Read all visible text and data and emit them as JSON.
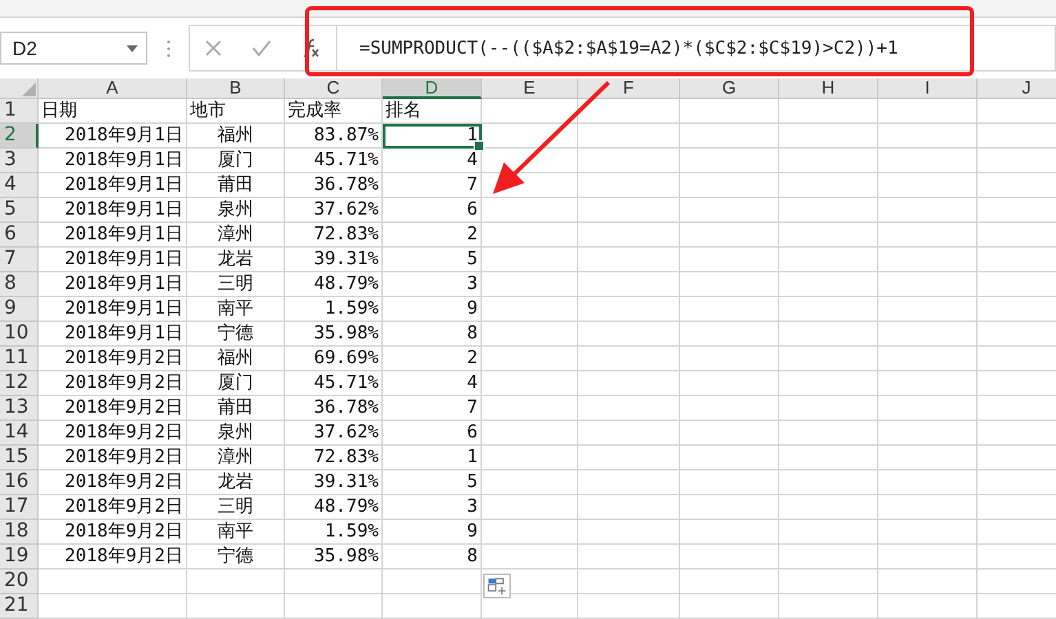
{
  "name_box": {
    "value": "D2"
  },
  "formula_bar": {
    "formula": "=SUMPRODUCT(--(($A$2:$A$19=A2)*($C$2:$C$19)>C2))+1"
  },
  "columns": [
    {
      "label": "A",
      "selected": false
    },
    {
      "label": "B",
      "selected": false
    },
    {
      "label": "C",
      "selected": false
    },
    {
      "label": "D",
      "selected": true
    },
    {
      "label": "E",
      "selected": false
    },
    {
      "label": "F",
      "selected": false
    },
    {
      "label": "G",
      "selected": false
    },
    {
      "label": "H",
      "selected": false
    },
    {
      "label": "I",
      "selected": false
    },
    {
      "label": "J",
      "selected": false
    }
  ],
  "rows": [
    {
      "number": "1",
      "kind": "header",
      "selected": false,
      "cells": [
        "日期",
        "地市",
        "完成率",
        "排名"
      ]
    },
    {
      "number": "2",
      "kind": "data",
      "selected": true,
      "cells": [
        "2018年9月1日",
        "福州",
        "83.87%",
        "1"
      ]
    },
    {
      "number": "3",
      "kind": "data",
      "selected": false,
      "cells": [
        "2018年9月1日",
        "厦门",
        "45.71%",
        "4"
      ]
    },
    {
      "number": "4",
      "kind": "data",
      "selected": false,
      "cells": [
        "2018年9月1日",
        "莆田",
        "36.78%",
        "7"
      ]
    },
    {
      "number": "5",
      "kind": "data",
      "selected": false,
      "cells": [
        "2018年9月1日",
        "泉州",
        "37.62%",
        "6"
      ]
    },
    {
      "number": "6",
      "kind": "data",
      "selected": false,
      "cells": [
        "2018年9月1日",
        "漳州",
        "72.83%",
        "2"
      ]
    },
    {
      "number": "7",
      "kind": "data",
      "selected": false,
      "cells": [
        "2018年9月1日",
        "龙岩",
        "39.31%",
        "5"
      ]
    },
    {
      "number": "8",
      "kind": "data",
      "selected": false,
      "cells": [
        "2018年9月1日",
        "三明",
        "48.79%",
        "3"
      ]
    },
    {
      "number": "9",
      "kind": "data",
      "selected": false,
      "cells": [
        "2018年9月1日",
        "南平",
        "1.59%",
        "9"
      ]
    },
    {
      "number": "10",
      "kind": "data",
      "selected": false,
      "cells": [
        "2018年9月1日",
        "宁德",
        "35.98%",
        "8"
      ]
    },
    {
      "number": "11",
      "kind": "data",
      "selected": false,
      "cells": [
        "2018年9月2日",
        "福州",
        "69.69%",
        "2"
      ]
    },
    {
      "number": "12",
      "kind": "data",
      "selected": false,
      "cells": [
        "2018年9月2日",
        "厦门",
        "45.71%",
        "4"
      ]
    },
    {
      "number": "13",
      "kind": "data",
      "selected": false,
      "cells": [
        "2018年9月2日",
        "莆田",
        "36.78%",
        "7"
      ]
    },
    {
      "number": "14",
      "kind": "data",
      "selected": false,
      "cells": [
        "2018年9月2日",
        "泉州",
        "37.62%",
        "6"
      ]
    },
    {
      "number": "15",
      "kind": "data",
      "selected": false,
      "cells": [
        "2018年9月2日",
        "漳州",
        "72.83%",
        "1"
      ]
    },
    {
      "number": "16",
      "kind": "data",
      "selected": false,
      "cells": [
        "2018年9月2日",
        "龙岩",
        "39.31%",
        "5"
      ]
    },
    {
      "number": "17",
      "kind": "data",
      "selected": false,
      "cells": [
        "2018年9月2日",
        "三明",
        "48.79%",
        "3"
      ]
    },
    {
      "number": "18",
      "kind": "data",
      "selected": false,
      "cells": [
        "2018年9月2日",
        "南平",
        "1.59%",
        "9"
      ]
    },
    {
      "number": "19",
      "kind": "data",
      "selected": false,
      "cells": [
        "2018年9月2日",
        "宁德",
        "35.98%",
        "8"
      ]
    },
    {
      "number": "20",
      "kind": "empty",
      "selected": false,
      "cells": []
    },
    {
      "number": "21",
      "kind": "empty",
      "selected": false,
      "cells": []
    }
  ]
}
